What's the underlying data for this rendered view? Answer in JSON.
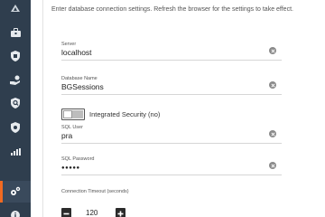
{
  "intro_text": "Enter database connection settings. Refresh the browser for the settings to take effect.",
  "sidebar": {
    "items": [
      {
        "icon": "briefcase-icon"
      },
      {
        "icon": "shield-icon"
      },
      {
        "icon": "hand-coins-icon"
      },
      {
        "icon": "shield-search-icon"
      },
      {
        "icon": "shield-gear-icon"
      },
      {
        "icon": "bar-chart-icon"
      },
      {
        "icon": "gears-icon",
        "active": true
      },
      {
        "icon": "info-icon"
      }
    ]
  },
  "form": {
    "server": {
      "label": "Server",
      "value": "localhost"
    },
    "database": {
      "label": "Database Name",
      "value": "BGSessions"
    },
    "integrated_security": {
      "label": "Integrated Security (no)",
      "enabled": false
    },
    "sql_user": {
      "label": "SQL User",
      "value": "pra"
    },
    "sql_password": {
      "label": "SQL Password",
      "value": "●●●●●"
    },
    "timeout": {
      "label": "Connection Timeout (seconds)",
      "value": "120"
    }
  },
  "colors": {
    "sidebar_bg": "#2f3e4e",
    "accent": "#f26a21"
  }
}
